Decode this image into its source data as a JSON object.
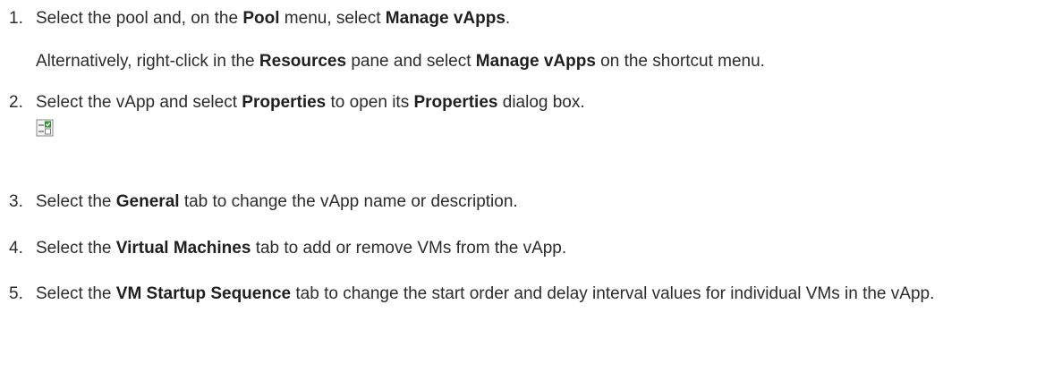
{
  "steps": [
    {
      "number": "1.",
      "segments": [
        {
          "text": "Select the pool and, on the ",
          "bold": false
        },
        {
          "text": "Pool",
          "bold": true
        },
        {
          "text": " menu, select ",
          "bold": false
        },
        {
          "text": "Manage vApps",
          "bold": true
        },
        {
          "text": ".",
          "bold": false
        }
      ],
      "note": [
        {
          "text": "Alternatively, right-click in the ",
          "bold": false
        },
        {
          "text": "Resources",
          "bold": true
        },
        {
          "text": " pane and select ",
          "bold": false
        },
        {
          "text": "Manage vApps",
          "bold": true
        },
        {
          "text": " on the shortcut menu.",
          "bold": false
        }
      ]
    },
    {
      "number": "2.",
      "segments": [
        {
          "text": "Select the vApp and select ",
          "bold": false
        },
        {
          "text": "Properties",
          "bold": true
        },
        {
          "text": " to open its ",
          "bold": false
        },
        {
          "text": "Properties",
          "bold": true
        },
        {
          "text": " dialog box.",
          "bold": false
        }
      ],
      "icon": "properties-icon"
    },
    {
      "number": "3.",
      "segments": [
        {
          "text": "Select the ",
          "bold": false
        },
        {
          "text": "General",
          "bold": true
        },
        {
          "text": " tab to change the vApp name or description.",
          "bold": false
        }
      ]
    },
    {
      "number": "4.",
      "segments": [
        {
          "text": "Select the ",
          "bold": false
        },
        {
          "text": "Virtual Machines",
          "bold": true
        },
        {
          "text": " tab to add or remove VMs from the vApp.",
          "bold": false
        }
      ]
    },
    {
      "number": "5.",
      "segments": [
        {
          "text": "Select the ",
          "bold": false
        },
        {
          "text": "VM Startup Sequence",
          "bold": true
        },
        {
          "text": " tab to change the start order and delay interval values for individual VMs in the vApp.",
          "bold": false
        }
      ]
    }
  ],
  "colors": {
    "text": "#2b2b2b",
    "icon_green": "#3aa63a",
    "icon_gray": "#7a7a7a"
  }
}
